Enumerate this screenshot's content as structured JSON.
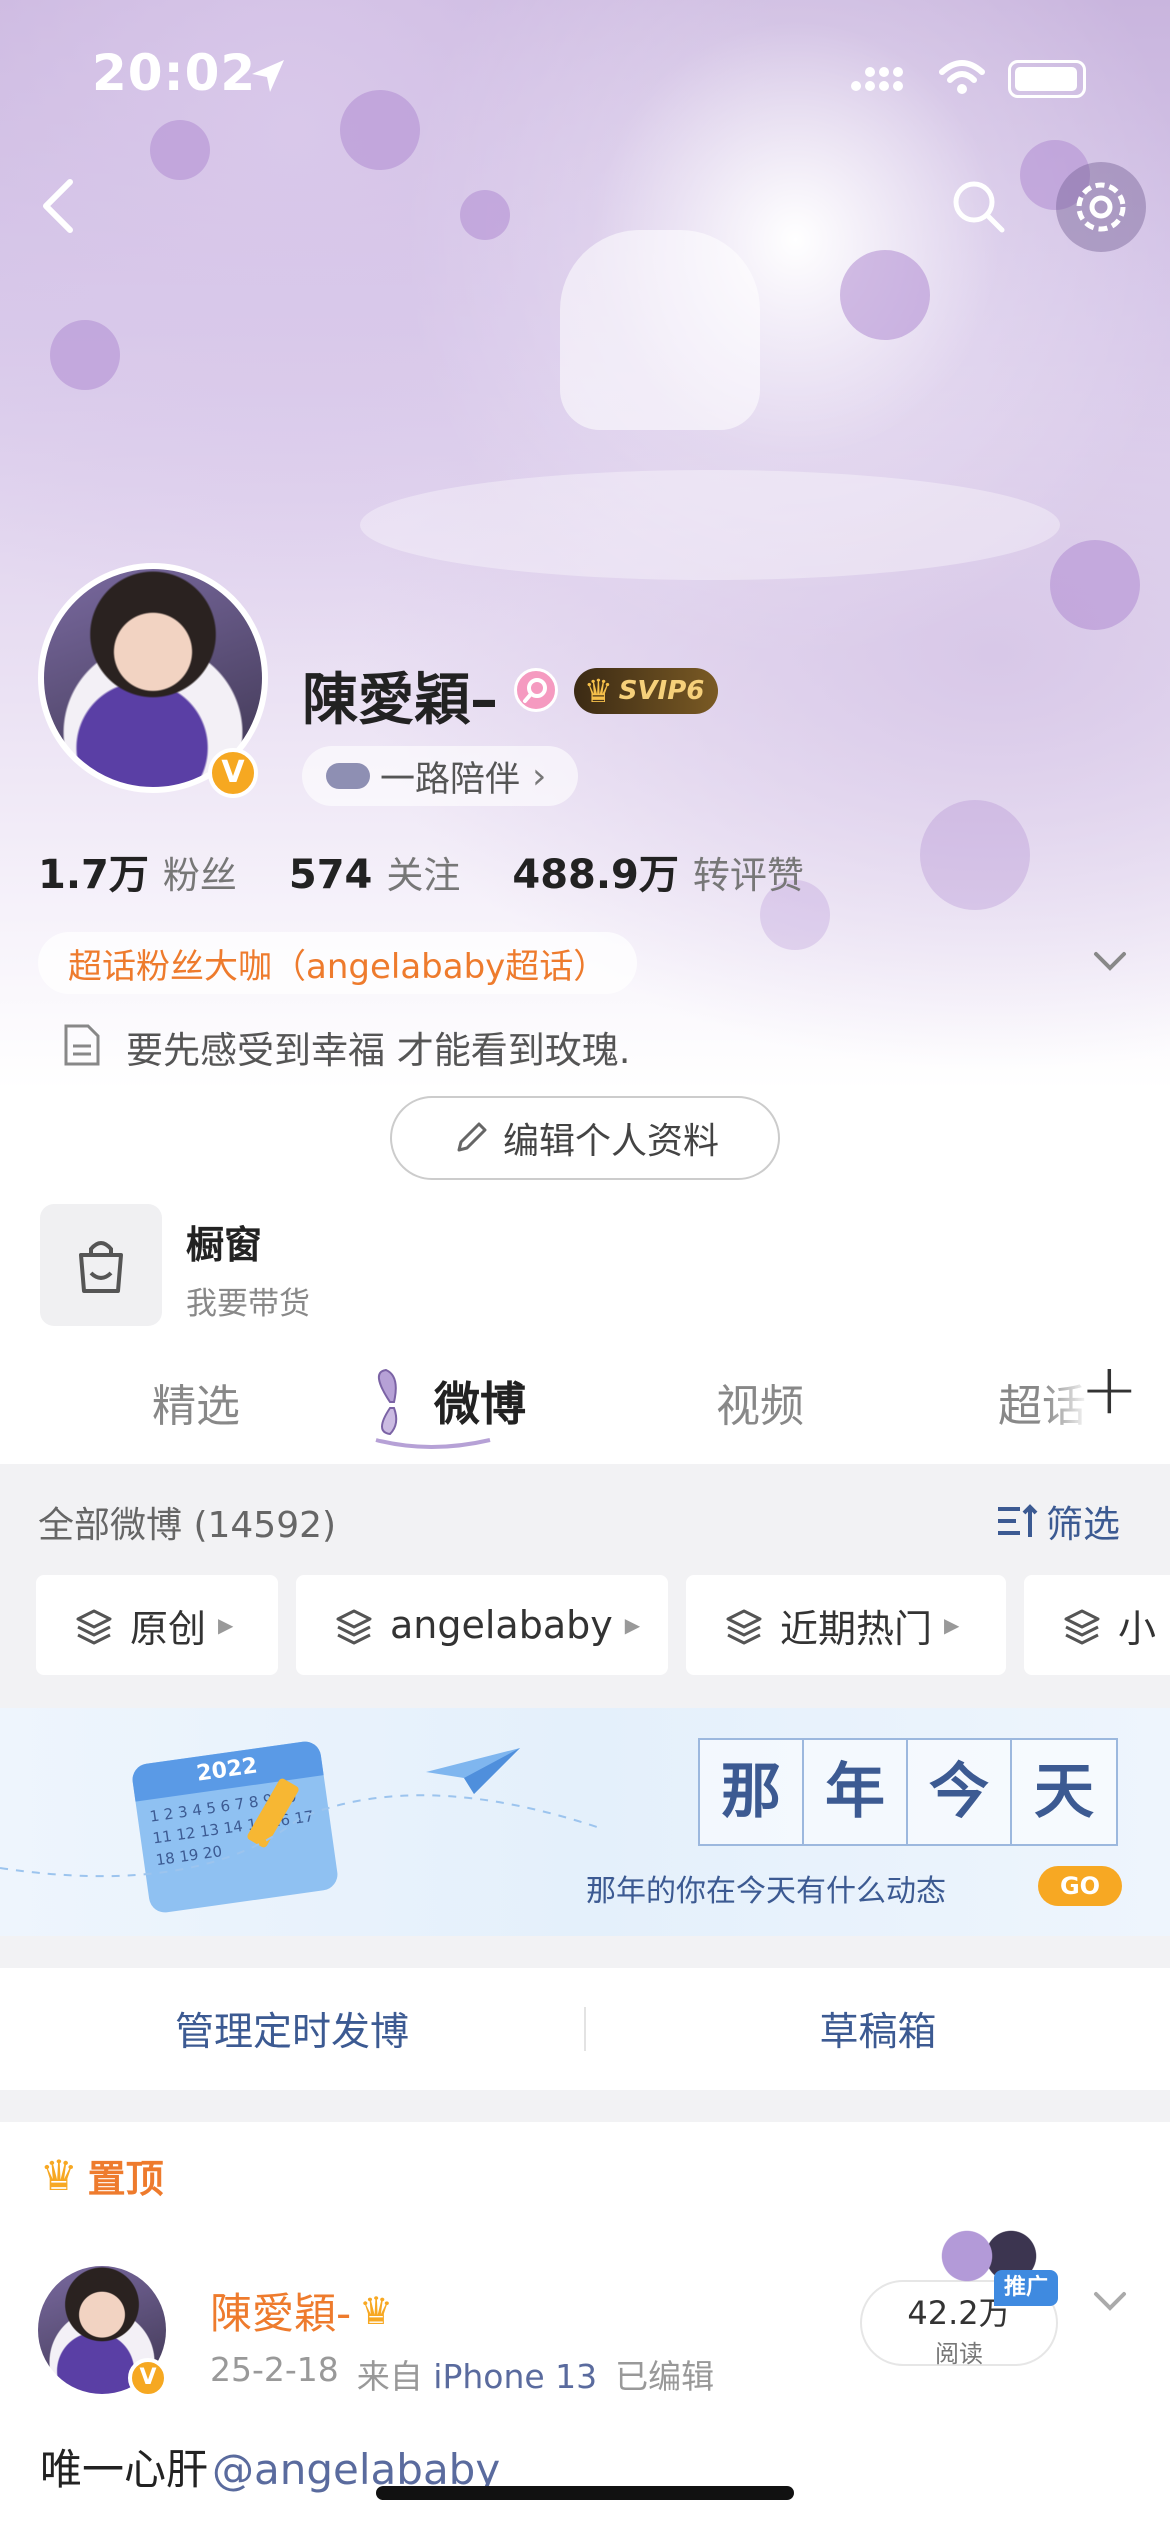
{
  "status_bar": {
    "time": "20:02"
  },
  "profile": {
    "name": "陳愛穎–",
    "vip_badge": "SVIP6",
    "companion_label": "一路陪伴",
    "companion_chevron": "›",
    "stats": [
      {
        "value": "1.7万",
        "label": "粉丝"
      },
      {
        "value": "574",
        "label": "关注"
      },
      {
        "value": "488.9万",
        "label": "转评赞"
      }
    ],
    "super_topic_tag": "超话粉丝大咖（angelababy超话）",
    "bio": "要先感受到幸福 才能看到玫瑰.",
    "edit_button": "编辑个人资料"
  },
  "shop": {
    "title": "橱窗",
    "subtitle": "我要带货"
  },
  "tabs": [
    {
      "label": "精选"
    },
    {
      "label": "微博"
    },
    {
      "label": "视频"
    },
    {
      "label": "超话"
    }
  ],
  "tab_add_icon": "+",
  "feed_header": {
    "count_label": "全部微博 (14592)",
    "filter_label": "筛选"
  },
  "filter_chips": [
    {
      "label": "原创"
    },
    {
      "label": "angelababy"
    },
    {
      "label": "近期热门"
    },
    {
      "label": "小"
    }
  ],
  "memory_banner": {
    "year": "2022",
    "chars": [
      "那",
      "年",
      "今",
      "天"
    ],
    "subtitle": "那年的你在今天有什么动态",
    "go_label": "GO",
    "calendar_numbers": "1 2 3 4 5 6 7 8 9 10 11 12 13 14 15 16 17 18 19 20"
  },
  "actions": {
    "scheduled": "管理定时发博",
    "drafts": "草稿箱"
  },
  "pinned_label": "置顶",
  "post": {
    "author": "陳愛穎-",
    "date": "25-2-18",
    "source_prefix": "来自",
    "source": "iPhone 13",
    "edited": "已编辑",
    "reads": "42.2万",
    "reads_label": "阅读",
    "promo_tag": "推广",
    "text": "唯一心肝",
    "mention": "@angelababy"
  },
  "colors": {
    "accent_orange": "#ee7b2d",
    "blue_text": "#3c5a92",
    "link": "#5a6b9e",
    "gold": "#f6a821"
  }
}
